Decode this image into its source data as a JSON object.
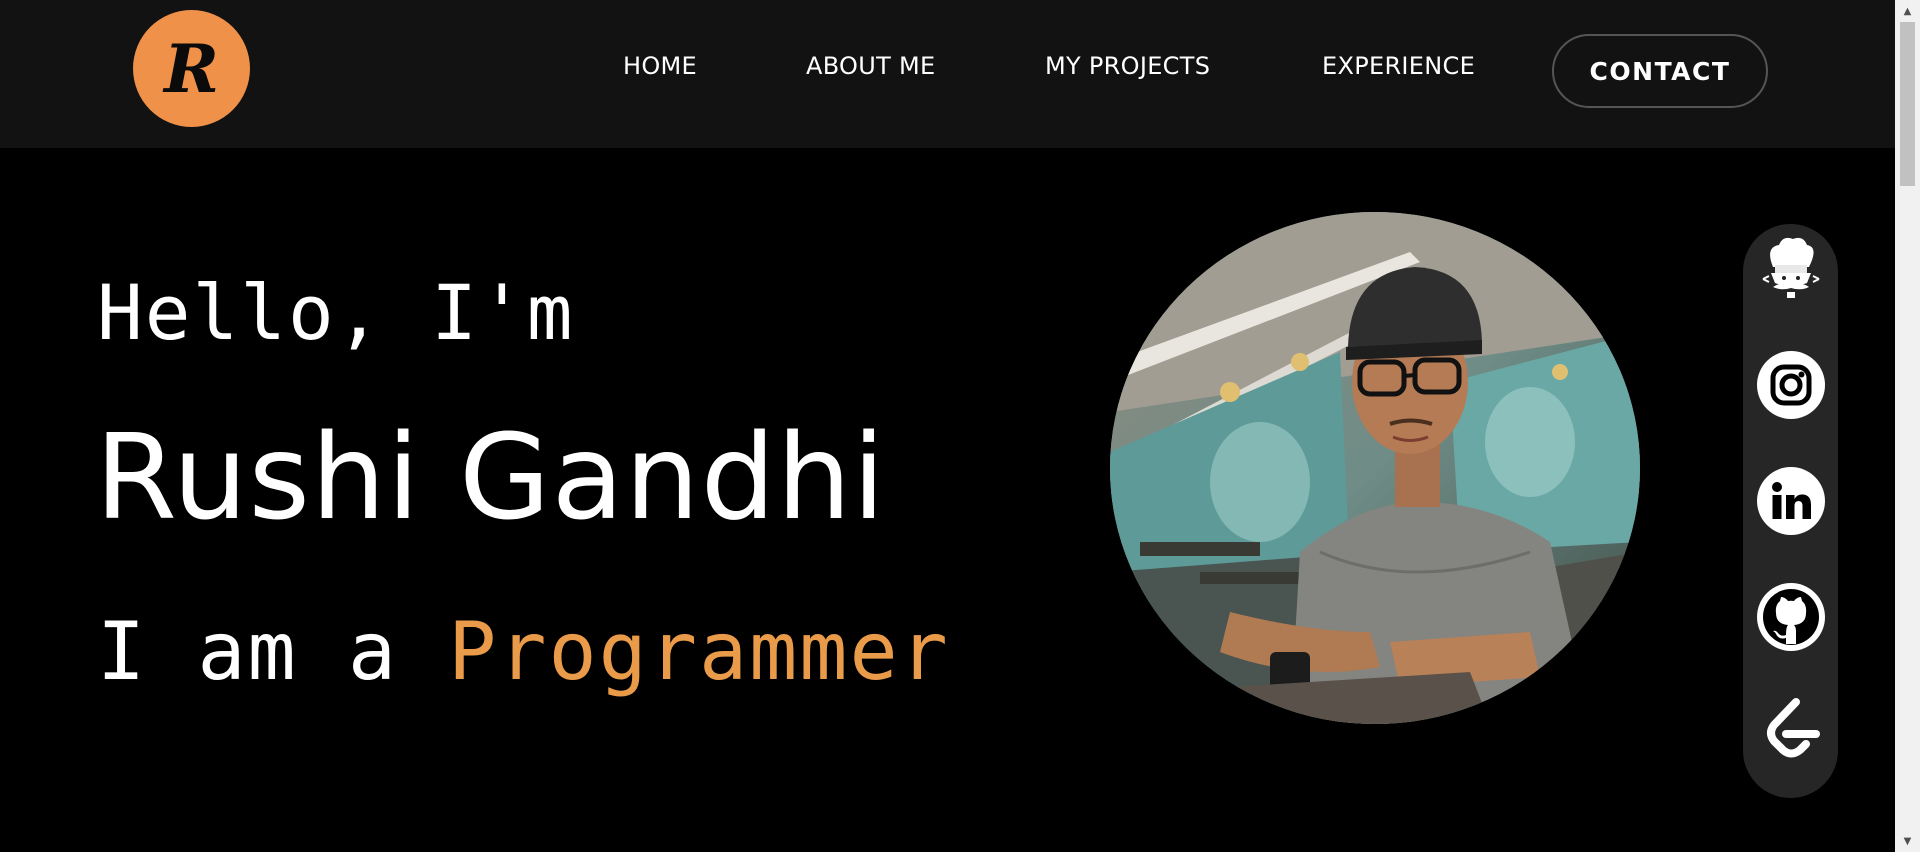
{
  "logo": {
    "letter": "R",
    "color": "#f0914a"
  },
  "nav": {
    "items": [
      {
        "label": "HOME"
      },
      {
        "label": "ABOUT ME"
      },
      {
        "label": "MY PROJECTS"
      },
      {
        "label": "EXPERIENCE"
      }
    ],
    "contact_label": "CONTACT"
  },
  "hero": {
    "greeting": "Hello, I'm",
    "name": "Rushi Gandhi",
    "role_prefix": "I am a ",
    "role_word": "Programmer",
    "accent_color": "#e99b4a"
  },
  "profile_photo": {
    "icon": "profile-photo"
  },
  "social": [
    {
      "icon": "codechef-icon"
    },
    {
      "icon": "instagram-icon"
    },
    {
      "icon": "linkedin-icon"
    },
    {
      "icon": "github-icon"
    },
    {
      "icon": "leetcode-icon"
    }
  ]
}
